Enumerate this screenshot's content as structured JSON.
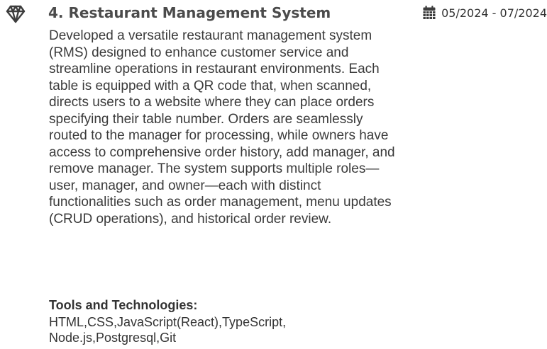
{
  "project": {
    "title": "4. Restaurant Management System",
    "icon": "gem-icon",
    "date_icon": "calendar-icon",
    "date_range": "05/2024 - 07/2024",
    "description": "Developed a versatile restaurant management system (RMS) designed to enhance customer service and streamline operations in restaurant environments.  Each table is equipped with a QR code that, when scanned, directs users to a website where they can place orders specifying their table number. Orders are seamlessly routed to the manager for processing, while owners have access to comprehensive order history, add manager, and remove manager. The system supports multiple roles—user, manager, and owner—each with distinct functionalities such as order management, menu updates (CRUD operations), and historical order review.",
    "tools_heading": "Tools and Technologies:",
    "tools": "HTML,CSS,JavaScript(React),TypeScript, Node.js,Postgresql,Git"
  },
  "colors": {
    "icon": "#3d3d3d",
    "title": "#4b4b4b",
    "text": "#333333"
  }
}
